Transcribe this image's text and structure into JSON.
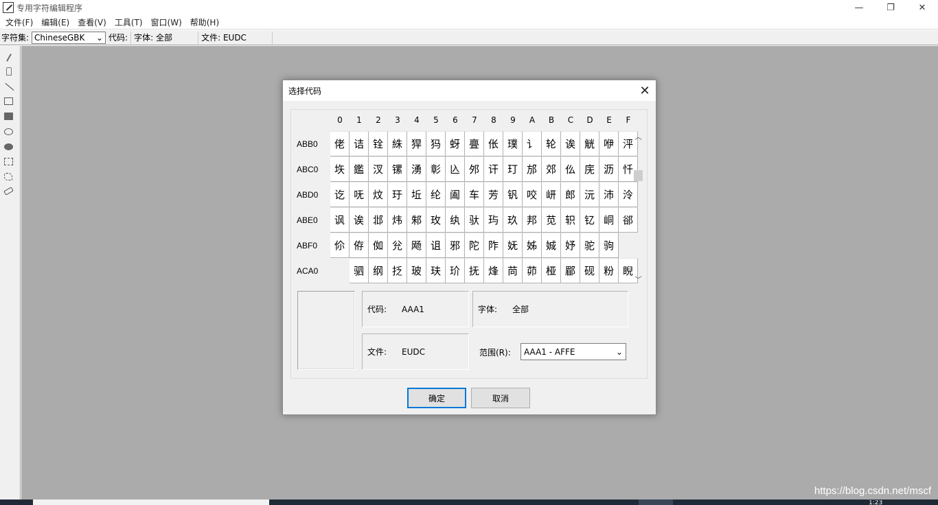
{
  "window": {
    "title": "专用字符编辑程序",
    "minimize_glyph": "—",
    "restore_glyph": "❐",
    "close_glyph": "✕"
  },
  "menu": [
    {
      "label": "文件(F)"
    },
    {
      "label": "编辑(E)"
    },
    {
      "label": "查看(V)"
    },
    {
      "label": "工具(T)"
    },
    {
      "label": "窗口(W)"
    },
    {
      "label": "帮助(H)"
    }
  ],
  "toolbar": {
    "charset_label": "字符集:",
    "charset_value": "ChineseGBK",
    "code_label": "代码:",
    "font_text": "字体: 全部",
    "file_text": "文件: EUDC"
  },
  "tools": [
    "pencil-icon",
    "brush-icon",
    "line-icon",
    "rectangle-icon",
    "filled-rectangle-icon",
    "ellipse-icon",
    "filled-ellipse-icon",
    "rect-select-icon",
    "freeform-select-icon",
    "eraser-icon"
  ],
  "dialog": {
    "title": "选择代码",
    "close_glyph": "✕",
    "columns": [
      "0",
      "1",
      "2",
      "3",
      "4",
      "5",
      "6",
      "7",
      "8",
      "9",
      "A",
      "B",
      "C",
      "D",
      "E",
      "F"
    ],
    "rows": [
      {
        "label": "ABB0",
        "chars": [
          "佬",
          "诘",
          "铨",
          "絑",
          "猂",
          "犸",
          "蚜",
          "亹",
          "伥",
          "璞",
          "讠",
          "轮",
          "诶",
          "觥",
          "咿",
          "泙"
        ]
      },
      {
        "label": "ABC0",
        "chars": [
          "垁",
          "鑑",
          "汊",
          "镙",
          "湧",
          "彰",
          "兦",
          "邜",
          "讦",
          "玎",
          "邡",
          "郊",
          "仫",
          "庑",
          "沥",
          "忏"
        ]
      },
      {
        "label": "ABD0",
        "chars": [
          "讫",
          "呒",
          "炆",
          "玗",
          "坵",
          "纶",
          "阖",
          "车",
          "芳",
          "钒",
          "咬",
          "岍",
          "郎",
          "沅",
          "沛",
          "泠"
        ]
      },
      {
        "label": "ABE0",
        "chars": [
          "讽",
          "诶",
          "邶",
          "炜",
          "邾",
          "玫",
          "纨",
          "驮",
          "玙",
          "玖",
          "邦",
          "苋",
          "轵",
          "钇",
          "峒",
          "郤"
        ]
      },
      {
        "label": "ABF0",
        "chars": [
          "伱",
          "侟",
          "侞",
          "兊",
          "飏",
          "诅",
          "邪",
          "陀",
          "阼",
          "妩",
          "姊",
          "娍",
          "妤",
          "驼",
          "驹",
          ""
        ]
      },
      {
        "label": "ACA0",
        "chars": [
          "",
          "驷",
          "纲",
          "抸",
          "玻",
          "玞",
          "玠",
          "抚",
          "烽",
          "苘",
          "茆",
          "桠",
          "郿",
          "砚",
          "粉",
          "睨"
        ]
      }
    ],
    "preview_char": "",
    "code_label": "代码:",
    "code_value": "AAA1",
    "font_label": "字体:",
    "font_value": "全部",
    "file_label": "文件:",
    "file_value": "EUDC",
    "range_label": "范围(R):",
    "range_value": "AAA1 - AFFE",
    "ok_label": "确定",
    "cancel_label": "取消",
    "scroll_up_glyph": "︿",
    "scroll_down_glyph": "﹀"
  },
  "watermark": "https://blog.csdn.net/mscf",
  "tray_text": "1:23"
}
